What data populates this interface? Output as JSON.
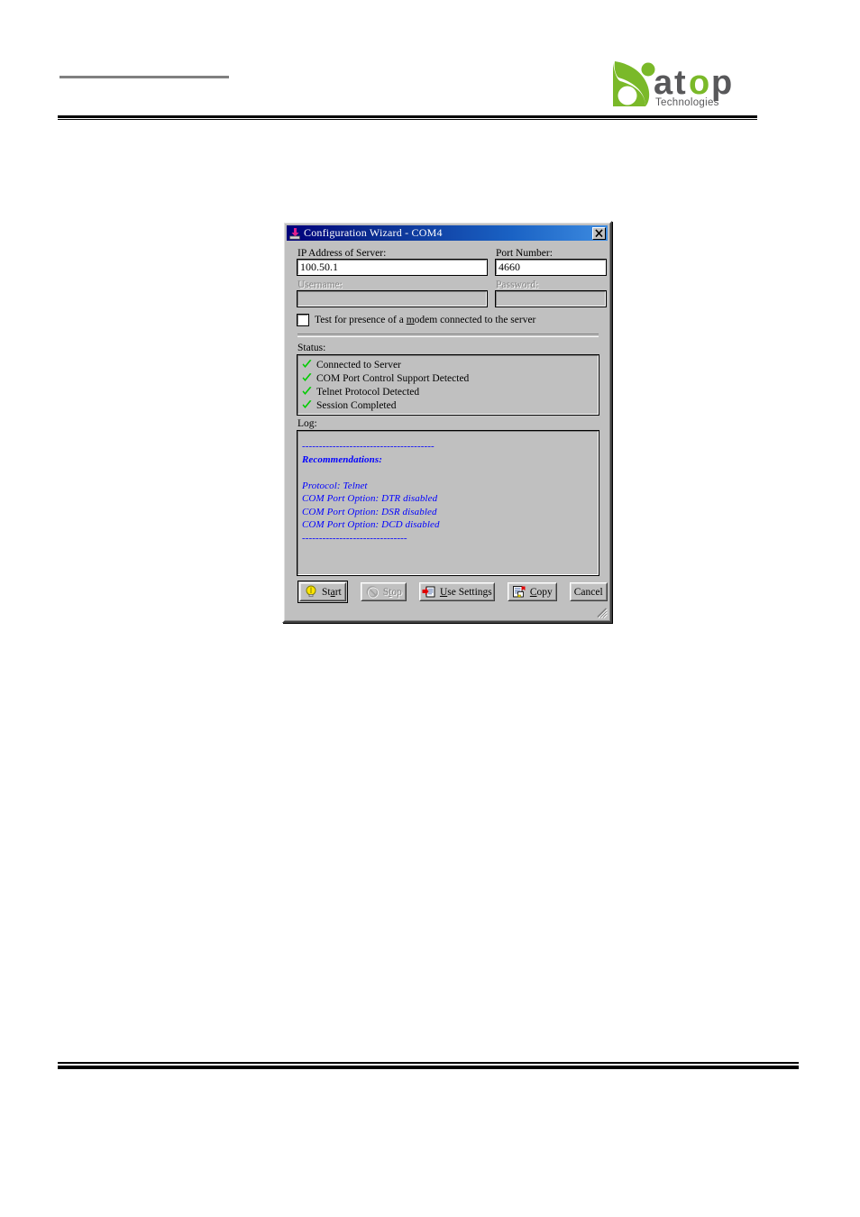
{
  "page": {
    "header_rule": "header-rule",
    "footer_rule": "footer-rule"
  },
  "logo": {
    "name": "atop-technologies-logo",
    "wordmark": "atop",
    "tagline": "Technologies",
    "green": "#7ab929",
    "gray": "#58585a"
  },
  "dialog": {
    "title": "Configuration Wizard - COM4",
    "title_icon": "install-arrow-icon",
    "close_label": "✕",
    "fields": {
      "ip_label": "IP Address of Server:",
      "ip_value": "100.50.1",
      "ip_placeholder": "",
      "port_label": "Port Number:",
      "port_value": "4660",
      "port_placeholder": "",
      "username_label": "Username:",
      "username_value": "",
      "username_placeholder": "",
      "password_label": "Password:",
      "password_value": "",
      "password_placeholder": ""
    },
    "checkbox": {
      "label_before": "Test for presence of a ",
      "label_accel": "m",
      "label_after": "odem connected to the server",
      "checked": false
    },
    "status": {
      "label": "Status:",
      "check_color": "#00cc00",
      "items": [
        "Connected to Server",
        "COM Port Control Support Detected",
        "Telnet Protocol Detected",
        "Session Completed"
      ]
    },
    "log": {
      "label": "Log:",
      "text_color": "#0000ff",
      "lines": [
        {
          "text": "",
          "bold": false
        },
        {
          "text": "---------------------------------------",
          "bold": false
        },
        {
          "text": "Recommendations:",
          "bold": true
        },
        {
          "text": "",
          "bold": false
        },
        {
          "text": "Protocol: Telnet",
          "bold": false
        },
        {
          "text": "COM Port Option: DTR disabled",
          "bold": false
        },
        {
          "text": "COM Port Option: DSR disabled",
          "bold": false
        },
        {
          "text": "COM Port Option: DCD disabled",
          "bold": false
        },
        {
          "text": "-------------------------------",
          "bold": false
        }
      ]
    },
    "buttons": {
      "start": {
        "label": "St",
        "accel": "a",
        "label_after": "rt",
        "icon": "lightbulb-icon",
        "disabled": false,
        "default": true
      },
      "stop": {
        "label": "S",
        "accel": "t",
        "label_after": "op",
        "icon": "no-entry-icon",
        "disabled": true,
        "default": false
      },
      "use_settings": {
        "label": "",
        "accel": "U",
        "label_after": "se Settings",
        "icon": "apply-settings-icon",
        "disabled": false,
        "default": false
      },
      "copy": {
        "label": "",
        "accel": "C",
        "label_after": "opy",
        "icon": "copy-document-icon",
        "disabled": false,
        "default": false
      },
      "cancel": {
        "label": "Cancel",
        "accel": "",
        "label_after": "",
        "icon": "",
        "disabled": false,
        "default": false
      }
    },
    "resize_grip": "resize-grip"
  }
}
